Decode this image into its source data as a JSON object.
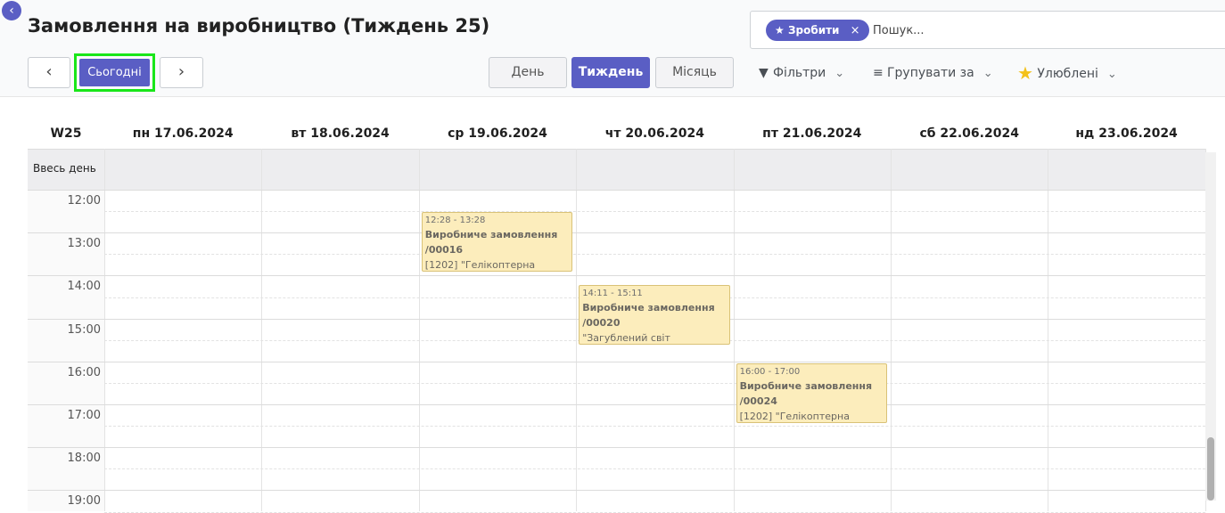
{
  "header": {
    "title": "Замовлення на виробництво (Тиждень 25)",
    "back_icon": "chevron-left-icon",
    "prev_label": "‹",
    "next_label": "›",
    "today_label": "Сьогодні"
  },
  "scales": {
    "day": "День",
    "week": "Тиждень",
    "month": "Місяць",
    "active": "week"
  },
  "search": {
    "facet_label": "Зробити",
    "facet_remove": "×",
    "placeholder": "Пошук..."
  },
  "toolbar": {
    "filters": "Фільтри",
    "group_by": "Групувати за",
    "favorites": "Улюблені"
  },
  "calendar": {
    "week_label": "W25",
    "days": [
      "пн 17.06.2024",
      "вт 18.06.2024",
      "ср 19.06.2024",
      "чт 20.06.2024",
      "пт 21.06.2024",
      "сб 22.06.2024",
      "нд 23.06.2024"
    ],
    "all_day_label": "Ввесь день",
    "hours": [
      "12:00",
      "13:00",
      "14:00",
      "15:00",
      "16:00",
      "17:00",
      "18:00",
      "19:00"
    ],
    "events": [
      {
        "day_index": 2,
        "time": "12:28 - 13:28",
        "name": "Виробниче замовлення /00016",
        "detail": "[1202] \"Гелікоптерна",
        "start": 12.47,
        "end": 13.47
      },
      {
        "day_index": 3,
        "time": "14:11 - 15:11",
        "name": "Виробниче замовлення /00020",
        "detail": "\"Загублений світ",
        "start": 14.18,
        "end": 15.18
      },
      {
        "day_index": 4,
        "time": "16:00 - 17:00",
        "name": "Виробниче замовлення /00024",
        "detail": "[1202] \"Гелікоптерна",
        "start": 16.0,
        "end": 17.0
      }
    ]
  },
  "colors": {
    "primary": "#5a5ec4",
    "event_bg": "#fcedbc",
    "today_highlight": "#19e619"
  }
}
